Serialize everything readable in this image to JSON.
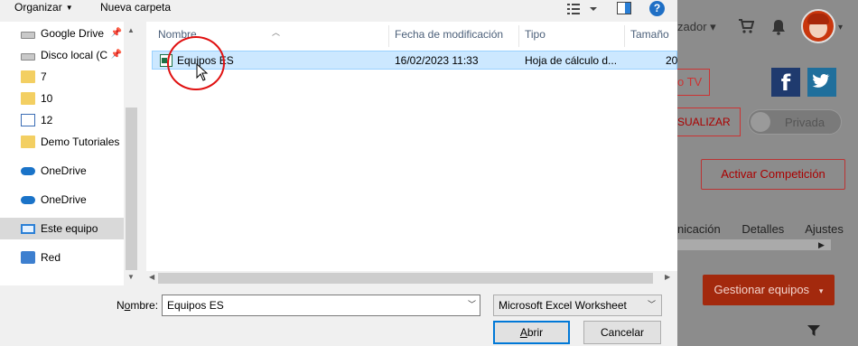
{
  "toolbar": {
    "organize_label": "Organizar",
    "new_folder_label": "Nueva carpeta",
    "help_label": "?"
  },
  "nav": {
    "items": [
      {
        "label": "Google Drive",
        "icon": "drive-icon",
        "pinned": true
      },
      {
        "label": "Disco local (C",
        "icon": "drive-icon",
        "pinned": true
      },
      {
        "label": "7",
        "icon": "folder-icon"
      },
      {
        "label": "10",
        "icon": "folder-icon"
      },
      {
        "label": "12",
        "icon": "document-icon"
      },
      {
        "label": "Demo Tutoriales",
        "icon": "folder-icon"
      },
      {
        "label": "OneDrive",
        "icon": "cloud-icon"
      },
      {
        "label": "OneDrive",
        "icon": "cloud-icon"
      },
      {
        "label": "Este equipo",
        "icon": "computer-icon",
        "selected": true
      },
      {
        "label": "Red",
        "icon": "network-icon"
      }
    ]
  },
  "files": {
    "columns": [
      "Nombre",
      "Fecha de modificación",
      "Tipo",
      "Tamaño"
    ],
    "rows": [
      {
        "name": "Equipos ES",
        "modified": "16/02/2023 11:33",
        "type": "Hoja de cálculo d...",
        "size": "20"
      }
    ]
  },
  "footer": {
    "filename_label_prefix": "N",
    "filename_label_underlined": "o",
    "filename_label_suffix": "mbre:",
    "filename_value": "Equipos ES",
    "filetype_value": "Microsoft Excel Worksheet",
    "open_label_underlined": "A",
    "open_label_rest": "brir",
    "cancel_label": "Cancelar"
  },
  "background_app": {
    "user_label": "zador",
    "tv_label": "o TV",
    "visualize_label": "SUALIZAR",
    "private_label": "Privada",
    "activate_competition_label": "Activar Competición",
    "tabs": [
      "nicación",
      "Detalles",
      "Ajustes"
    ],
    "manage_teams_label": "Gestionar equipos",
    "manage_teams_caret": "▾"
  },
  "colors": {
    "selection_bg": "#cce8ff",
    "selection_border": "#99d1ff",
    "highlight_circle": "#e01010",
    "accent_button": "#0078d7",
    "brand_red": "#a3290d"
  }
}
